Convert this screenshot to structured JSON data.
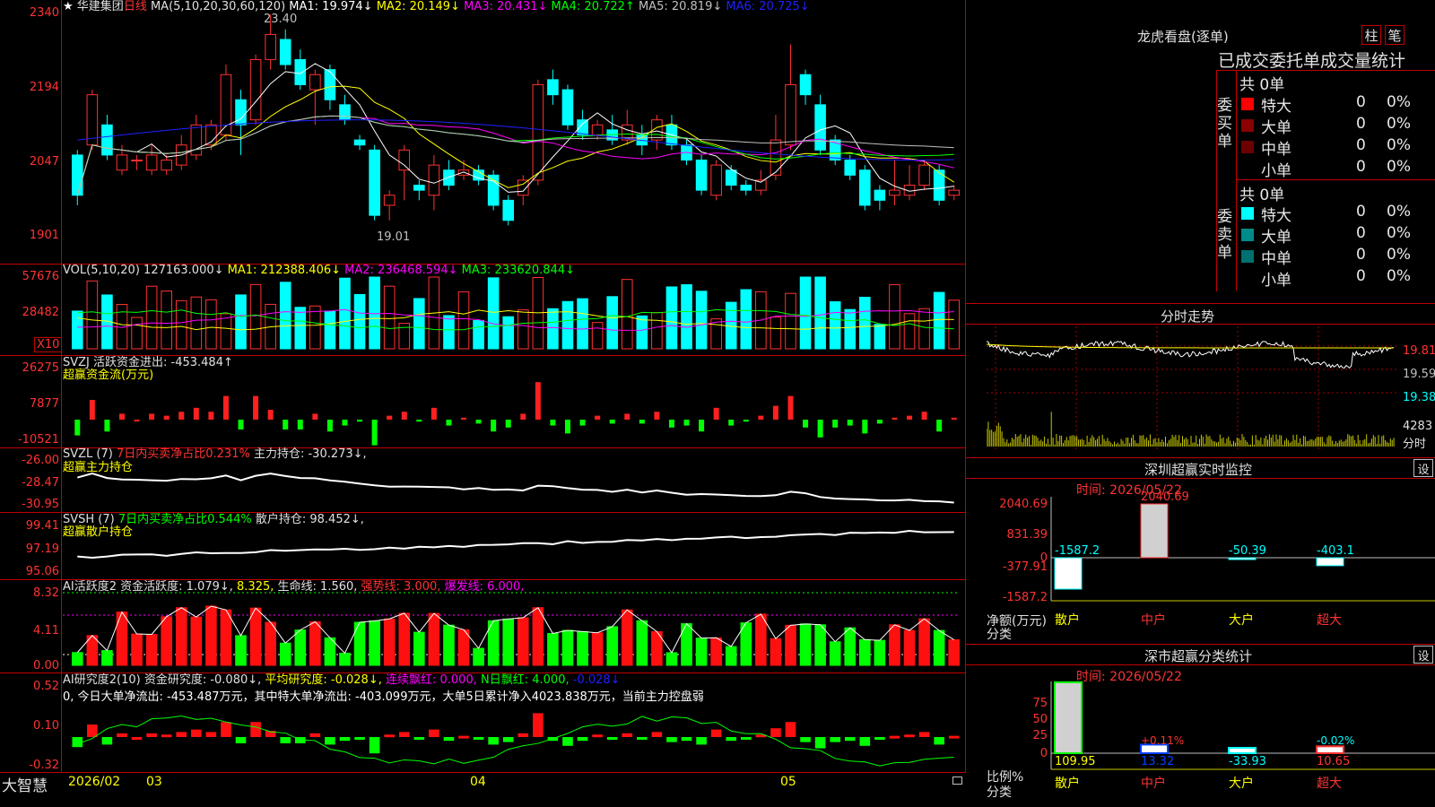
{
  "stock": {
    "name": "华建集团",
    "period": "日线"
  },
  "ma_header": {
    "params": "MA(5,10,20,30,60,120)",
    "ma1": "MA1: 19.974↓",
    "ma2": "MA2: 20.149↓",
    "ma3": "MA3: 20.431↓",
    "ma4": "MA4: 20.722↑",
    "ma5": "MA5: 20.819↓",
    "ma6": "MA6: 20.725↓"
  },
  "price_axis": [
    "2340",
    "2194",
    "2047",
    "1901"
  ],
  "price_annotations": {
    "high": "23.40",
    "low": "19.01"
  },
  "vol_header": {
    "params": "VOL(5,10,20)",
    "value": "127163.000↓",
    "ma1": "MA1: 212388.406↓",
    "ma2": "MA2: 236468.594↓",
    "ma3": "MA3: 233620.844↓"
  },
  "vol_axis": [
    "57676",
    "28482"
  ],
  "vol_unit": "X10",
  "svzj": {
    "line1": "SVZJ  活跃资金进出: -453.484↑",
    "line2": "超赢资金流(万元)",
    "axis": [
      "26275",
      "7877",
      "-10521"
    ]
  },
  "svzl": {
    "label": "SVZL (7)",
    "note": "7日内买卖净占比0.231%",
    "value": "主力持仓: -30.273↓,",
    "line2": "超赢主力持仓",
    "axis": [
      "-26.00",
      "-28.47",
      "-30.95"
    ]
  },
  "svsh": {
    "label": "SVSH (7)",
    "note": "7日内买卖净占比0.544%",
    "value": "散户持仓: 98.452↓,",
    "line2": "超赢散户持仓",
    "axis": [
      "99.41",
      "97.19",
      "95.06"
    ]
  },
  "ai_active": {
    "label": "AI活跃度2 资金活跃度: 1.079↓,",
    "v2": "8.325,",
    "life": "生命线: 1.560,",
    "strong": "强势线: 3.000,",
    "burst": "爆发线: 6.000,",
    "axis": [
      "8.32",
      "4.11",
      "0.00"
    ]
  },
  "ai_research": {
    "label": "AI研究度2(10) 资金研究度: -0.080↓,",
    "avg": "平均研究度: -0.028↓,",
    "red": "连续飘红: 0.000,",
    "nred": "N日飘红: 4.000,",
    "last": "-0.028↓",
    "summary": "0, 今日大单净流出: -453.487万元，其中特大单净流出: -403.099万元，大单5日累计净入4023.838万元，当前主力控盘弱",
    "axis": [
      "0.52",
      "0.10",
      "-0.32"
    ]
  },
  "footer": {
    "brand": "大智慧",
    "months": [
      "2026/02",
      "03",
      "04",
      "05"
    ]
  },
  "dragon": {
    "title": "龙虎看盘(逐单)",
    "btn_a": "柱",
    "btn_b": "笔",
    "sub": "已成交委托单成交量统计",
    "buy": {
      "side": "委买单",
      "count": "共 0单",
      "rows": [
        {
          "label": "特大",
          "value": "0",
          "pct": "0%",
          "color": "#ff0000"
        },
        {
          "label": "大单",
          "value": "0",
          "pct": "0%",
          "color": "#8b0000"
        },
        {
          "label": "中单",
          "value": "0",
          "pct": "0%",
          "color": "#6b0000"
        },
        {
          "label": "小单",
          "value": "0",
          "pct": "0%",
          "color": ""
        }
      ]
    },
    "sell": {
      "side": "委卖单",
      "count": "共 0单",
      "rows": [
        {
          "label": "特大",
          "value": "0",
          "pct": "0%",
          "color": "#00ffff"
        },
        {
          "label": "大单",
          "value": "0",
          "pct": "0%",
          "color": "#008b8b"
        },
        {
          "label": "中单",
          "value": "0",
          "pct": "0%",
          "color": "#007070"
        },
        {
          "label": "小单",
          "value": "0",
          "pct": "0%",
          "color": ""
        }
      ]
    }
  },
  "intraday": {
    "title": "分时走势",
    "prices": [
      "19.81",
      "19.59",
      "19.38"
    ],
    "vol": "4283",
    "unit": "分时"
  },
  "monitor": {
    "title": "深圳超赢实时监控",
    "btn": "设",
    "date": "时间: 2026/05/22",
    "axis": [
      "2040.69",
      "831.39",
      "0",
      "-377.91",
      "-1587.2"
    ],
    "ylabel": "净额(万元)",
    "xlabel": "分类",
    "bars": [
      {
        "cat": "散户",
        "value": "-1587.2"
      },
      {
        "cat": "中户",
        "value": "2040.69"
      },
      {
        "cat": "大户",
        "value": "-50.39"
      },
      {
        "cat": "超大",
        "value": "-403.1"
      }
    ]
  },
  "classify": {
    "title": "深市超赢分类统计",
    "btn": "设",
    "date": "时间: 2026/05/22",
    "axis": [
      "75",
      "50",
      "25",
      "0"
    ],
    "ylabel": "比例%",
    "xlabel": "分类",
    "bars": [
      {
        "cat": "散户",
        "value": "109.95",
        "top": ""
      },
      {
        "cat": "中户",
        "value": "13.32",
        "top": "+0.11%"
      },
      {
        "cat": "大户",
        "value": "-33.93",
        "top": ""
      },
      {
        "cat": "超大",
        "value": "10.65",
        "top": "-0.02%"
      }
    ]
  },
  "chart_data": {
    "type": "candlestick",
    "title": "华建集团 日线",
    "x_labels": [
      "2026/02",
      "03",
      "04",
      "05"
    ],
    "ylim": [
      19.01,
      23.4
    ],
    "ohlc": [
      [
        20.6,
        19.8,
        20.7,
        19.6
      ],
      [
        20.8,
        21.8,
        21.9,
        20.7
      ],
      [
        21.2,
        20.6,
        21.4,
        20.5
      ],
      [
        20.3,
        20.6,
        20.8,
        20.2
      ],
      [
        20.5,
        20.5,
        20.6,
        20.3
      ],
      [
        20.3,
        20.6,
        20.8,
        20.2
      ],
      [
        20.3,
        20.5,
        20.6,
        20.2
      ],
      [
        20.4,
        20.8,
        21.0,
        20.3
      ],
      [
        20.6,
        21.2,
        21.4,
        20.5
      ],
      [
        20.8,
        21.2,
        21.3,
        20.7
      ],
      [
        21.0,
        22.2,
        22.4,
        20.9
      ],
      [
        21.7,
        21.2,
        21.9,
        20.6
      ],
      [
        21.3,
        22.5,
        22.6,
        21.2
      ],
      [
        22.5,
        23.0,
        23.4,
        22.3
      ],
      [
        22.9,
        22.4,
        23.1,
        22.3
      ],
      [
        22.5,
        22.0,
        22.7,
        21.9
      ],
      [
        21.9,
        22.2,
        22.3,
        21.2
      ],
      [
        22.3,
        21.7,
        22.4,
        21.5
      ],
      [
        21.6,
        21.3,
        21.8,
        21.2
      ],
      [
        20.9,
        20.8,
        21.0,
        20.7
      ],
      [
        20.7,
        19.4,
        20.8,
        19.3
      ],
      [
        19.6,
        19.8,
        19.9,
        19.3
      ],
      [
        20.3,
        20.7,
        20.8,
        19.7
      ],
      [
        20.0,
        19.9,
        20.1,
        19.7
      ],
      [
        19.8,
        20.4,
        20.6,
        19.5
      ],
      [
        20.3,
        20.0,
        20.5,
        19.9
      ],
      [
        20.2,
        20.3,
        20.5,
        20.1
      ],
      [
        20.3,
        20.1,
        20.4,
        20.0
      ],
      [
        20.2,
        19.6,
        20.3,
        19.5
      ],
      [
        19.7,
        19.3,
        19.8,
        19.2
      ],
      [
        19.8,
        20.1,
        20.2,
        19.6
      ],
      [
        20.1,
        22.0,
        22.1,
        20.0
      ],
      [
        22.1,
        21.8,
        22.3,
        21.6
      ],
      [
        21.9,
        21.2,
        22.0,
        21.1
      ],
      [
        21.3,
        21.0,
        21.5,
        20.9
      ],
      [
        21.0,
        21.2,
        21.3,
        20.9
      ],
      [
        21.1,
        20.9,
        21.4,
        20.8
      ],
      [
        20.9,
        21.2,
        21.5,
        20.8
      ],
      [
        21.0,
        20.8,
        21.2,
        20.6
      ],
      [
        20.9,
        21.3,
        21.4,
        20.7
      ],
      [
        21.2,
        20.8,
        21.4,
        20.7
      ],
      [
        20.8,
        20.5,
        20.9,
        20.4
      ],
      [
        20.5,
        19.9,
        20.6,
        19.8
      ],
      [
        19.8,
        20.4,
        20.5,
        19.7
      ],
      [
        20.3,
        20.0,
        20.4,
        19.9
      ],
      [
        20.0,
        19.9,
        20.1,
        19.8
      ],
      [
        19.9,
        20.1,
        20.3,
        19.8
      ],
      [
        20.2,
        20.9,
        21.4,
        20.1
      ],
      [
        20.8,
        22.0,
        22.8,
        20.7
      ],
      [
        22.2,
        21.8,
        22.3,
        21.6
      ],
      [
        21.6,
        20.7,
        21.8,
        20.6
      ],
      [
        20.9,
        20.5,
        21.0,
        20.4
      ],
      [
        20.5,
        20.2,
        20.6,
        20.1
      ],
      [
        20.3,
        19.6,
        20.4,
        19.5
      ],
      [
        19.9,
        19.7,
        20.0,
        19.5
      ],
      [
        19.8,
        19.9,
        20.5,
        19.6
      ],
      [
        19.8,
        20.0,
        20.4,
        19.7
      ],
      [
        20.0,
        20.4,
        20.5,
        19.9
      ],
      [
        20.3,
        19.7,
        20.4,
        19.6
      ],
      [
        19.8,
        19.9,
        20.0,
        19.7
      ]
    ]
  }
}
